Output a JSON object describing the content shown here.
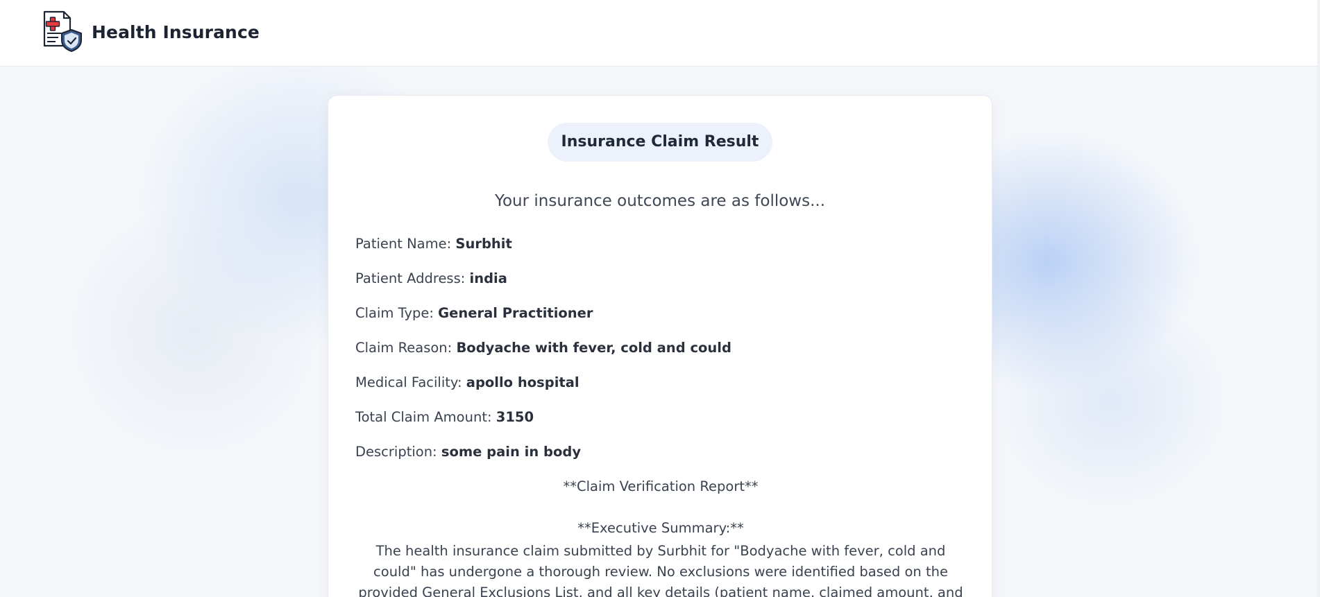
{
  "header": {
    "title": "Health Insurance",
    "logo_icon": "insurance-document-shield-icon"
  },
  "card": {
    "badge": "Insurance Claim Result",
    "subtitle": "Your insurance outcomes are as follows..."
  },
  "fields": [
    {
      "label": "Patient Name:",
      "value": "Surbhit"
    },
    {
      "label": "Patient Address:",
      "value": "india"
    },
    {
      "label": "Claim Type:",
      "value": "General Practitioner"
    },
    {
      "label": "Claim Reason:",
      "value": "Bodyache with fever, cold and could"
    },
    {
      "label": "Medical Facility:",
      "value": "apollo hospital"
    },
    {
      "label": "Total Claim Amount:",
      "value": "3150"
    },
    {
      "label": "Description:",
      "value": "some pain in body"
    }
  ],
  "report": {
    "title": "**Claim Verification Report**",
    "summary_label": "**Executive Summary:**",
    "summary_text": "The health insurance claim submitted by Surbhit for \"Bodyache with fever, cold and could\" has undergone a thorough review. No exclusions were identified based on the provided General Exclusions List, and all key details (patient name, claimed amount, and diagnosis) perfectly match"
  },
  "colors": {
    "accent_logo_cross": "#e23b3b",
    "shield": "#2f4d7a",
    "pill_bg": "#edf1fb"
  }
}
